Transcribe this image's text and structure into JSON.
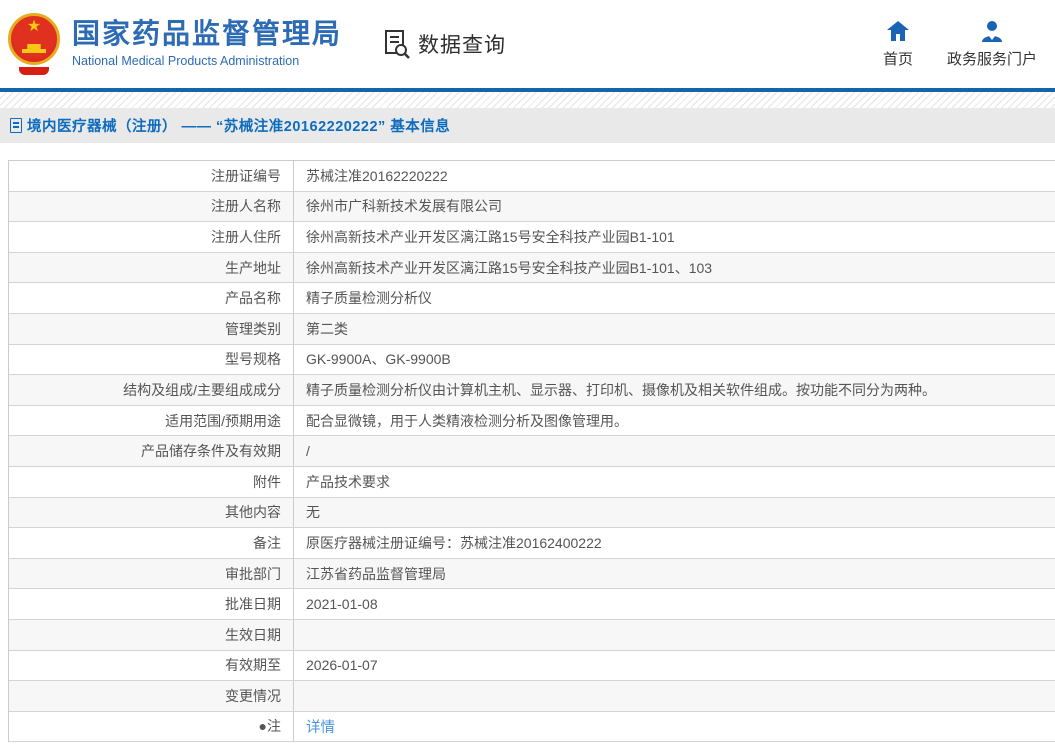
{
  "header": {
    "title_cn": "国家药品监督管理局",
    "title_en": "National Medical Products Administration",
    "query_label": "数据查询",
    "nav": [
      {
        "label": "首页"
      },
      {
        "label": "政务服务门户"
      }
    ]
  },
  "breadcrumb": {
    "text": "境内医疗器械（注册） —— “苏械注准20162220222” 基本信息"
  },
  "table": {
    "rows": [
      {
        "label": "注册证编号",
        "value": "苏械注准20162220222"
      },
      {
        "label": "注册人名称",
        "value": "徐州市广科新技术发展有限公司"
      },
      {
        "label": "注册人住所",
        "value": "徐州高新技术产业开发区漓江路15号安全科技产业园B1-101"
      },
      {
        "label": "生产地址",
        "value": "徐州高新技术产业开发区漓江路15号安全科技产业园B1-101、103"
      },
      {
        "label": "产品名称",
        "value": "精子质量检测分析仪"
      },
      {
        "label": "管理类别",
        "value": "第二类"
      },
      {
        "label": "型号规格",
        "value": "GK-9900A、GK-9900B"
      },
      {
        "label": "结构及组成/主要组成成分",
        "value": "精子质量检测分析仪由计算机主机、显示器、打印机、摄像机及相关软件组成。按功能不同分为两种。"
      },
      {
        "label": "适用范围/预期用途",
        "value": "配合显微镜，用于人类精液检测分析及图像管理用。"
      },
      {
        "label": "产品储存条件及有效期",
        "value": "/"
      },
      {
        "label": "附件",
        "value": "产品技术要求"
      },
      {
        "label": "其他内容",
        "value": "无"
      },
      {
        "label": "备注",
        "value": "原医疗器械注册证编号：苏械注准20162400222"
      },
      {
        "label": "审批部门",
        "value": "江苏省药品监督管理局"
      },
      {
        "label": "批准日期",
        "value": "2021-01-08"
      },
      {
        "label": "生效日期",
        "value": ""
      },
      {
        "label": "有效期至",
        "value": "2026-01-07"
      },
      {
        "label": "变更情况",
        "value": ""
      },
      {
        "label": "●注",
        "value": ""
      }
    ],
    "detail_link": "详情"
  },
  "colors": {
    "brand_blue": "#2d6cb5",
    "rule_blue": "#1565ab",
    "crumb_text": "#0e6cbe",
    "link_blue": "#4a94e0",
    "row_alt": "#f7f7f7"
  }
}
